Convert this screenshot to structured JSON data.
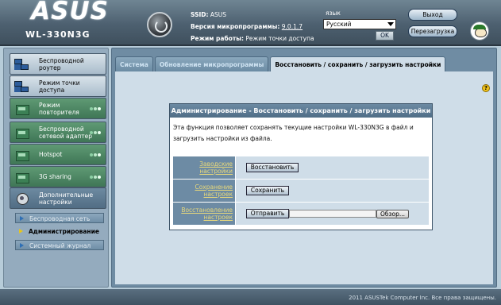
{
  "brand": {
    "logo": "ASUS",
    "model": "WL-330N3G"
  },
  "info": {
    "ssid_label": "SSID:",
    "ssid_value": "ASUS",
    "firmware_label": "Версия микропрограммы:",
    "firmware_value": "9.0.1.7",
    "mode_label": "Режим работы:",
    "mode_value": "Режим точки доступа"
  },
  "language": {
    "label": "язык",
    "selected": "Русский",
    "ok_label": "OK"
  },
  "header_buttons": {
    "logout": "Выход",
    "reboot": "Перезагрузка"
  },
  "sidebar": {
    "items": [
      {
        "label": "Беспроводной роутер",
        "icon": "router-icon",
        "style": "on"
      },
      {
        "label": "Режим точки доступа",
        "icon": "access-point-icon",
        "style": "on"
      },
      {
        "label": "Режим повторителя",
        "icon": "repeater-icon",
        "style": "grn"
      },
      {
        "label": "Беспроводной сетевой адаптер",
        "icon": "adapter-icon",
        "style": "grn"
      },
      {
        "label": "Hotspot",
        "icon": "hotspot-icon",
        "style": "grn"
      },
      {
        "label": "3G sharing",
        "icon": "3g-icon",
        "style": "grn"
      },
      {
        "label": "Дополнительные настройки",
        "icon": "gear-icon",
        "style": "adv"
      }
    ],
    "subitems": [
      {
        "label": "Беспроводная сеть",
        "selected": false
      },
      {
        "label": "Администрирование",
        "selected": true
      },
      {
        "label": "Системный журнал",
        "selected": false
      }
    ]
  },
  "tabs": [
    {
      "label": "Система",
      "active": false
    },
    {
      "label": "Обновление микропрограммы",
      "active": false
    },
    {
      "label": "Восстановить / сохранить / загрузить настройки",
      "active": true
    }
  ],
  "panel": {
    "title": "Администрирование - Восстановить / сохранить / загрузить настройки",
    "description": "Эта функция позволяет сохранять текущие настройки WL-330N3G в файл и загрузить настройки из файла.",
    "rows": [
      {
        "label": "Заводские настройки",
        "button": "Восстановить"
      },
      {
        "label": "Сохранение настроек",
        "button": "Сохранить"
      },
      {
        "label": "Восстановление настроек",
        "button": "Отправить",
        "browse": "Обзор..."
      }
    ]
  },
  "footer": {
    "copyright": "2011 ASUSTek Computer Inc.  Все права защищены."
  },
  "colors": {
    "header": "#4d6070",
    "sidebar": "#94abbe",
    "main": "#6f8ca3",
    "content": "#cfdde8",
    "panel_title": "#5b7992"
  }
}
